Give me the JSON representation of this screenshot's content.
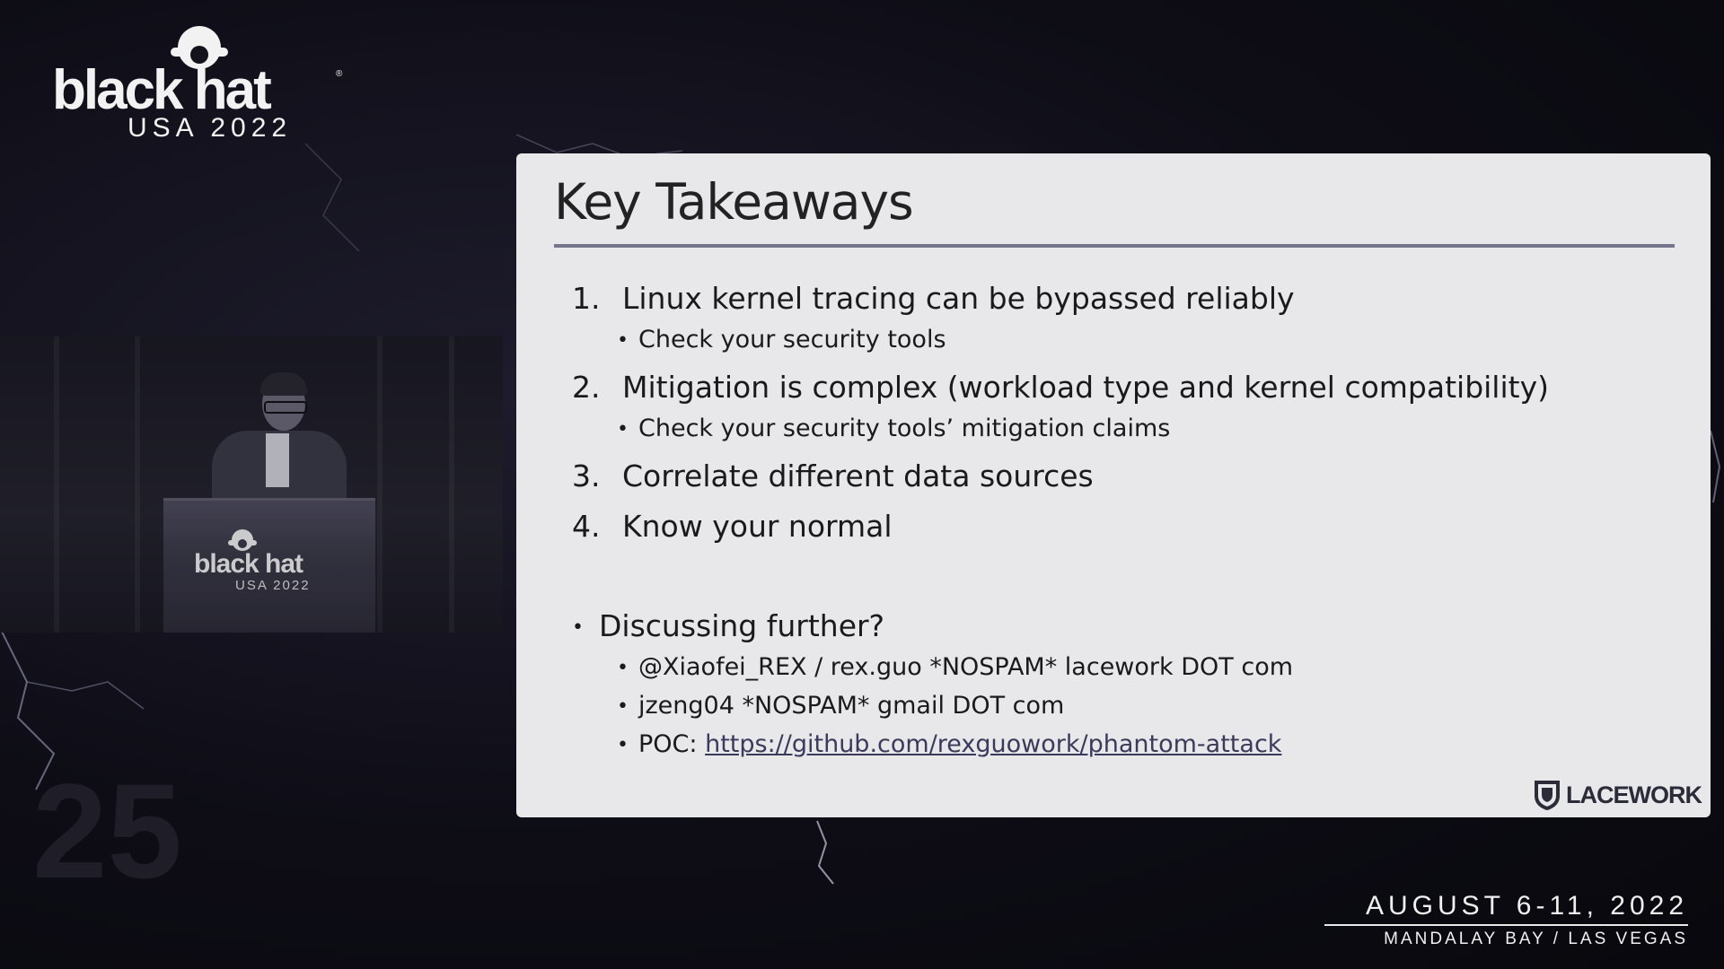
{
  "logo": {
    "wordmark": "black hat",
    "registered": "®",
    "edition": "USA 2022"
  },
  "podium": {
    "wordmark": "black hat",
    "edition": "USA 2022"
  },
  "watermark": "25",
  "slide": {
    "title": "Key Takeaways",
    "items": [
      {
        "number": "1.",
        "text": "Linux kernel tracing can be bypassed reliably",
        "sub": "Check your security tools"
      },
      {
        "number": "2.",
        "text": "Mitigation is complex (workload type and kernel compatibility)",
        "sub": "Check your security tools’ mitigation claims"
      },
      {
        "number": "3.",
        "text": "Correlate different data sources"
      },
      {
        "number": "4.",
        "text": "Know your normal"
      }
    ],
    "discussion": {
      "heading": "Discussing further?",
      "contacts": [
        "@Xiaofei_REX  / rex.guo *NOSPAM* lacework DOT com",
        "jzeng04 *NOSPAM* gmail DOT com"
      ],
      "poc_label": "POC: ",
      "poc_link": "https://github.com/rexguowork/phantom-attack"
    },
    "sponsor": "LACEWORK"
  },
  "event": {
    "dates": "AUGUST 6-11, 2022",
    "venue": "MANDALAY BAY / LAS VEGAS"
  },
  "colors": {
    "background": "#0e0d16",
    "slide": "#e8e8ea",
    "rule": "#75758e"
  }
}
